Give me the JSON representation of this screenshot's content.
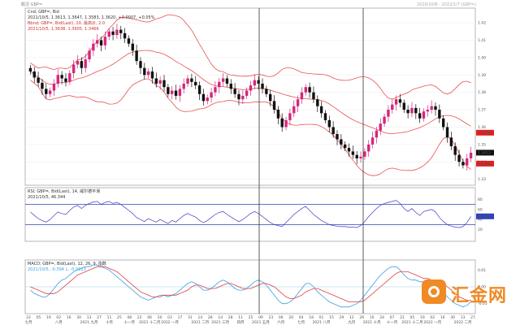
{
  "top_left_label": "概况 GBP=",
  "top_right_label": "2020/10/8 - 2022/1/7 (GBP=)",
  "chart_data": [
    {
      "type": "candlestick",
      "header": [
        "Cnd; GBP=, Bid",
        "2021/10/5, 1.3613, 1.3647, 1.3583, 1.3620, +0.0007, +0.05%"
      ],
      "legend": [
        "Bbnd; GBP=, Bid(Last), 20, 最高价, 2.0",
        "2021/10/5, 1.3638, 1.3605, 1.3466"
      ],
      "y_ticks": [
        "1.42",
        "1.41",
        "1.40",
        "1.39",
        "1.38",
        "1.37",
        "1.36",
        "1.35",
        "1.34",
        "1.33"
      ],
      "ylim": [
        1.3275,
        1.4275
      ],
      "tag_high": "1.3568",
      "tag_last": "1.3453",
      "tag_low": "1.3390",
      "colors": {
        "up": "#d4277a",
        "down": "#111111",
        "band": "#e85050",
        "tag_red": "#e0201f",
        "tag_black": "#111111"
      },
      "close": [
        1.392,
        1.3885,
        1.3855,
        1.382,
        1.379,
        1.381,
        1.385,
        1.39,
        1.388,
        1.386,
        1.391,
        1.396,
        1.398,
        1.394,
        1.399,
        1.404,
        1.408,
        1.41,
        1.407,
        1.412,
        1.415,
        1.413,
        1.416,
        1.414,
        1.411,
        1.408,
        1.404,
        1.398,
        1.394,
        1.39,
        1.392,
        1.388,
        1.385,
        1.387,
        1.383,
        1.379,
        1.381,
        1.378,
        1.382,
        1.385,
        1.388,
        1.386,
        1.384,
        1.379,
        1.375,
        1.377,
        1.38,
        1.383,
        1.386,
        1.388,
        1.385,
        1.382,
        1.379,
        1.376,
        1.378,
        1.381,
        1.384,
        1.387,
        1.385,
        1.382,
        1.379,
        1.375,
        1.37,
        1.365,
        1.36,
        1.364,
        1.368,
        1.372,
        1.376,
        1.38,
        1.383,
        1.38,
        1.376,
        1.372,
        1.368,
        1.364,
        1.36,
        1.356,
        1.353,
        1.35,
        1.348,
        1.346,
        1.344,
        1.342,
        1.343,
        1.346,
        1.35,
        1.354,
        1.358,
        1.362,
        1.366,
        1.37,
        1.373,
        1.376,
        1.374,
        1.37,
        1.368,
        1.371,
        1.368,
        1.365,
        1.369,
        1.37,
        1.372,
        1.37,
        1.365,
        1.36,
        1.354,
        1.349,
        1.344,
        1.34,
        1.338,
        1.342,
        1.3453
      ]
    },
    {
      "type": "line",
      "header": [
        "RSI; GBP=, Bid(Last), 14, 威尔德平滑"
      ],
      "value_label": "2021/10/5, 46.344",
      "levels": [
        70,
        30
      ],
      "ylim": [
        0,
        100
      ],
      "y_ticks": [
        "80",
        "60",
        "40",
        "20"
      ],
      "tag_value": "46.344",
      "color": "#4040c0",
      "values": [
        55,
        48,
        42,
        38,
        35,
        40,
        48,
        55,
        52,
        50,
        58,
        65,
        68,
        62,
        68,
        72,
        75,
        76,
        70,
        74,
        76,
        72,
        74,
        70,
        64,
        58,
        52,
        44,
        40,
        36,
        42,
        38,
        35,
        40,
        36,
        32,
        38,
        35,
        42,
        48,
        52,
        48,
        45,
        38,
        34,
        38,
        44,
        50,
        54,
        56,
        50,
        45,
        40,
        36,
        40,
        46,
        52,
        56,
        52,
        46,
        40,
        34,
        30,
        28,
        26,
        34,
        42,
        50,
        56,
        62,
        66,
        58,
        50,
        44,
        38,
        34,
        30,
        28,
        27,
        26,
        26,
        25,
        25,
        24,
        28,
        36,
        46,
        54,
        62,
        68,
        72,
        74,
        76,
        78,
        72,
        62,
        56,
        62,
        54,
        48,
        56,
        58,
        60,
        55,
        44,
        36,
        30,
        27,
        25,
        24,
        26,
        34,
        46
      ]
    },
    {
      "type": "line",
      "header": [
        "MACD; GBP=, Bid(Last), 12, 26, 9, 指数"
      ],
      "value_label": "2021/10/5, -0.394 L, -0.0013",
      "y_ticks": [
        "0.01",
        "0.00",
        "-0.01"
      ],
      "ylim": [
        -0.015,
        0.015
      ],
      "tag_values": [
        "0.0016",
        "-0.0013"
      ],
      "series": [
        {
          "color": "#3aa0e0",
          "values": [
            -0.002,
            -0.004,
            -0.005,
            -0.006,
            -0.006,
            -0.004,
            -0.001,
            0.002,
            0.004,
            0.005,
            0.007,
            0.009,
            0.01,
            0.011,
            0.012,
            0.012,
            0.013,
            0.013,
            0.012,
            0.011,
            0.01,
            0.008,
            0.006,
            0.004,
            0.002,
            0.0,
            -0.002,
            -0.004,
            -0.006,
            -0.007,
            -0.008,
            -0.007,
            -0.006,
            -0.005,
            -0.005,
            -0.006,
            -0.005,
            -0.004,
            -0.002,
            0.0,
            0.002,
            0.003,
            0.002,
            0.0,
            -0.002,
            -0.002,
            -0.001,
            0.001,
            0.003,
            0.004,
            0.003,
            0.001,
            -0.001,
            -0.002,
            -0.002,
            -0.001,
            0.001,
            0.003,
            0.004,
            0.003,
            0.001,
            -0.002,
            -0.005,
            -0.008,
            -0.01,
            -0.01,
            -0.009,
            -0.007,
            -0.004,
            -0.001,
            0.002,
            0.002,
            0.0,
            -0.003,
            -0.005,
            -0.007,
            -0.009,
            -0.01,
            -0.011,
            -0.012,
            -0.012,
            -0.012,
            -0.011,
            -0.01,
            -0.008,
            -0.005,
            -0.002,
            0.001,
            0.004,
            0.007,
            0.009,
            0.011,
            0.012,
            0.012,
            0.01,
            0.007,
            0.005,
            0.004,
            0.004,
            0.003,
            0.003,
            0.003,
            0.003,
            0.002,
            0.0,
            -0.003,
            -0.006,
            -0.008,
            -0.01,
            -0.011,
            -0.012,
            -0.011,
            -0.009
          ]
        },
        {
          "color": "#e04040",
          "values": [
            0.0,
            -0.001,
            -0.002,
            -0.003,
            -0.004,
            -0.004,
            -0.004,
            -0.003,
            -0.001,
            0.001,
            0.003,
            0.005,
            0.007,
            0.008,
            0.009,
            0.01,
            0.011,
            0.012,
            0.012,
            0.012,
            0.011,
            0.01,
            0.009,
            0.007,
            0.005,
            0.003,
            0.001,
            -0.001,
            -0.003,
            -0.004,
            -0.005,
            -0.006,
            -0.006,
            -0.006,
            -0.005,
            -0.005,
            -0.005,
            -0.005,
            -0.004,
            -0.003,
            -0.002,
            0.0,
            0.001,
            0.001,
            0.0,
            -0.001,
            -0.001,
            -0.001,
            0.0,
            0.001,
            0.002,
            0.002,
            0.001,
            0.0,
            -0.001,
            -0.001,
            -0.001,
            0.0,
            0.001,
            0.002,
            0.002,
            0.001,
            0.0,
            -0.002,
            -0.004,
            -0.006,
            -0.007,
            -0.007,
            -0.006,
            -0.005,
            -0.003,
            -0.002,
            -0.001,
            -0.001,
            -0.002,
            -0.003,
            -0.004,
            -0.005,
            -0.006,
            -0.007,
            -0.008,
            -0.009,
            -0.009,
            -0.009,
            -0.009,
            -0.008,
            -0.006,
            -0.004,
            -0.002,
            0.0,
            0.002,
            0.004,
            0.006,
            0.008,
            0.009,
            0.009,
            0.009,
            0.008,
            0.007,
            0.006,
            0.005,
            0.005,
            0.004,
            0.004,
            0.003,
            0.002,
            0.0,
            -0.002,
            -0.004,
            -0.006,
            -0.007,
            -0.008,
            -0.008
          ]
        }
      ]
    }
  ],
  "x_labels": [
    [
      "22",
      "七月"
    ],
    [
      "05",
      ""
    ],
    [
      "19",
      ""
    ],
    [
      "02",
      "八月"
    ],
    [
      "16",
      ""
    ],
    [
      "30",
      ""
    ],
    [
      "13",
      "2021 九月"
    ],
    [
      "27",
      ""
    ],
    [
      "11",
      "十月"
    ],
    [
      "25",
      ""
    ],
    [
      "08",
      "十一月"
    ],
    [
      "22",
      ""
    ],
    [
      "06",
      "2021 十二月"
    ],
    [
      "20",
      ""
    ],
    [
      "03",
      "2022 一月"
    ],
    [
      "17",
      ""
    ],
    [
      "31",
      ""
    ],
    [
      "14",
      "2021 二月"
    ],
    [
      "28",
      ""
    ],
    [
      "14",
      "2021 三月"
    ],
    [
      "28",
      ""
    ],
    [
      "11",
      "四月"
    ],
    [
      "25",
      ""
    ],
    [
      "09",
      "2021 五月"
    ],
    [
      "23",
      ""
    ],
    [
      "06",
      "六月"
    ],
    [
      "20",
      ""
    ],
    [
      "04",
      "七月"
    ],
    [
      "18",
      ""
    ],
    [
      "01",
      "2021 八月"
    ],
    [
      "15",
      ""
    ],
    [
      "29",
      ""
    ],
    [
      "12",
      "九月"
    ],
    [
      "26",
      ""
    ],
    [
      "10",
      "2021 十月"
    ],
    [
      "24",
      ""
    ],
    [
      "07",
      "十一月"
    ],
    [
      "21",
      ""
    ],
    [
      "05",
      "2021 十二月"
    ],
    [
      "19",
      ""
    ],
    [
      "02",
      "2022 一月"
    ],
    [
      "16",
      ""
    ],
    [
      "30",
      ""
    ],
    [
      "13",
      "2022 二月"
    ],
    [
      "27",
      ""
    ]
  ],
  "watermark": {
    "text": "汇金网",
    "color": "#f08a24"
  }
}
